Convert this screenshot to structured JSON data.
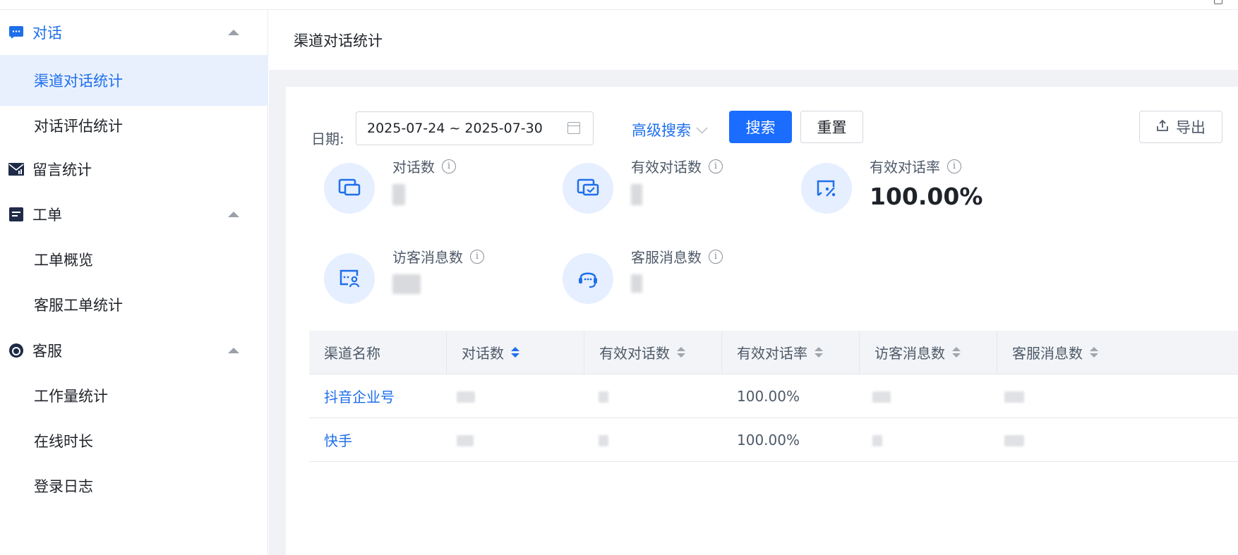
{
  "sidebar": {
    "groups": [
      {
        "label": "对话",
        "icon": "chat-icon",
        "items": [
          "渠道对话统计",
          "对话评估统计"
        ]
      },
      {
        "label": "留言统计",
        "icon": "mail-icon"
      },
      {
        "label": "工单",
        "icon": "ticket-icon",
        "items": [
          "工单概览",
          "客服工单统计"
        ]
      },
      {
        "label": "客服",
        "icon": "headset-icon",
        "items": [
          "工作量统计",
          "在线时长",
          "登录日志"
        ]
      }
    ],
    "active_item": "渠道对话统计"
  },
  "header": {
    "title": "渠道对话统计"
  },
  "filter": {
    "date_label": "日期:",
    "date_range": "2025-07-24 ~ 2025-07-30",
    "advanced_search": "高级搜索",
    "search_button": "搜索",
    "reset_button": "重置",
    "export_button": "导出"
  },
  "stats": [
    {
      "label": "对话数",
      "icon": "conversation-icon",
      "value": ""
    },
    {
      "label": "有效对话数",
      "icon": "valid-conversation-icon",
      "value": ""
    },
    {
      "label": "有效对话率",
      "icon": "rate-percent-icon",
      "value": "100.00%"
    },
    {
      "label": "访客消息数",
      "icon": "visitor-message-icon",
      "value": ""
    },
    {
      "label": "客服消息数",
      "icon": "agent-headset-icon",
      "value": ""
    }
  ],
  "table": {
    "columns": [
      "渠道名称",
      "对话数",
      "有效对话数",
      "有效对话率",
      "访客消息数",
      "客服消息数"
    ],
    "sorted_column": "对话数",
    "rows": [
      {
        "channel": "抖音企业号",
        "rate": "100.00%"
      },
      {
        "channel": "快手",
        "rate": "100.00%"
      }
    ]
  },
  "colors": {
    "accent": "#1a6dff",
    "active_bg": "#e8f0fe",
    "stat_circle": "#e6efff"
  }
}
